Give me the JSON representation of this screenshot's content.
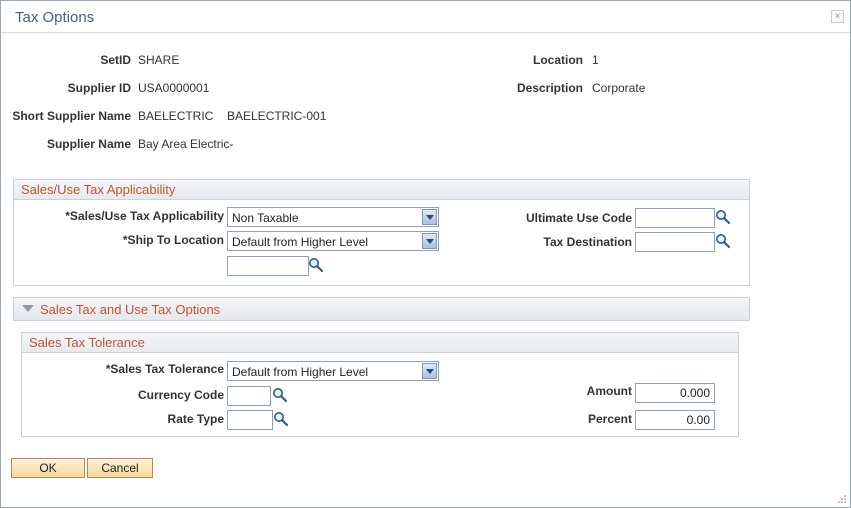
{
  "window": {
    "title": "Tax Options",
    "close_symbol": "×"
  },
  "header": {
    "setid_label": "SetID",
    "setid": "SHARE",
    "location_label": "Location",
    "location": "1",
    "supplier_id_label": "Supplier ID",
    "supplier_id": "USA0000001",
    "description_label": "Description",
    "description": "Corporate",
    "short_name_label": "Short Supplier Name",
    "short_name": "BAELECTRIC",
    "short_name_code": "BAELECTRIC-001",
    "supplier_name_label": "Supplier Name",
    "supplier_name": "Bay Area Electric-"
  },
  "applicability": {
    "title": "Sales/Use Tax Applicability",
    "sut_label": "*Sales/Use Tax Applicability",
    "sut_value": "Non Taxable",
    "ship_label": "*Ship To Location",
    "ship_value": "Default from Higher Level",
    "ship_code_value": "",
    "ult_use_label": "Ultimate Use Code",
    "ult_use_value": "",
    "tax_dest_label": "Tax Destination",
    "tax_dest_value": ""
  },
  "options_section": {
    "title": "Sales Tax and Use Tax Options"
  },
  "tolerance": {
    "title": "Sales Tax Tolerance",
    "tol_label": "*Sales Tax Tolerance",
    "tol_value": "Default from Higher Level",
    "currency_label": "Currency Code",
    "currency_value": "",
    "rate_label": "Rate Type",
    "rate_value": "",
    "amount_label": "Amount",
    "amount_value": "0.000",
    "percent_label": "Percent",
    "percent_value": "0.00"
  },
  "buttons": {
    "ok": "OK",
    "cancel": "Cancel"
  },
  "colors": {
    "section_title": "#c2552d",
    "window_title": "#4a5f82",
    "button": "#f5d89a"
  }
}
